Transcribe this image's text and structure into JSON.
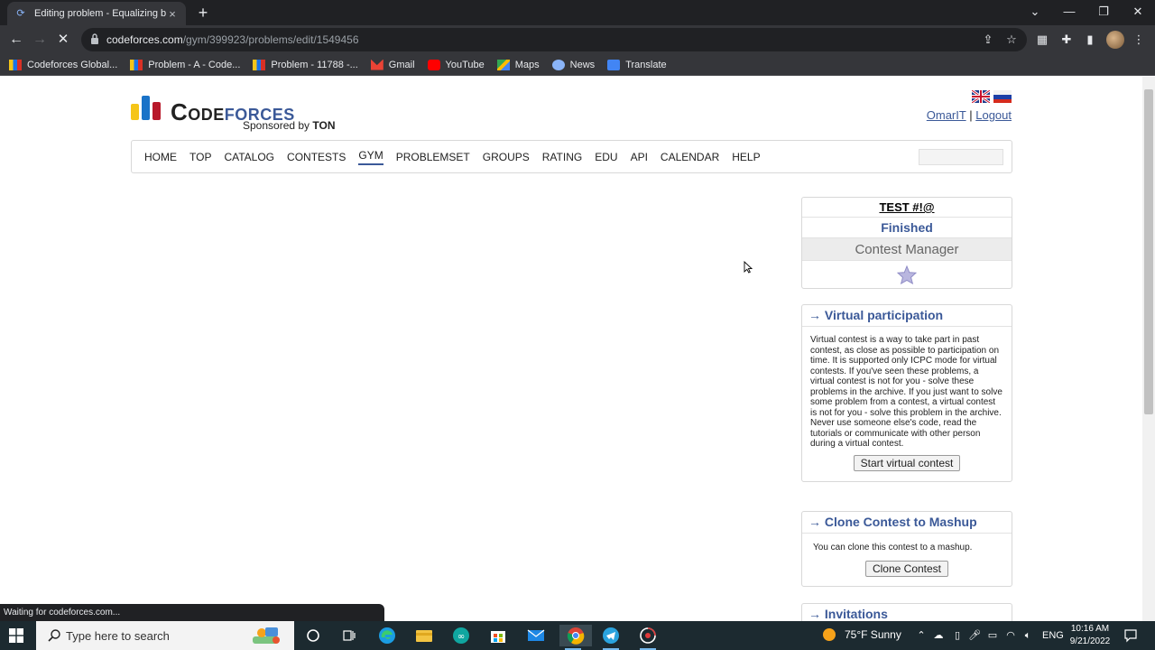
{
  "browser": {
    "tab_title": "Editing problem - Equalizing by ",
    "url_host": "codeforces.com",
    "url_path": "/gym/399923/problems/edit/1549456",
    "status_text": "Waiting for codeforces.com...",
    "bookmarks": [
      {
        "label": "Codeforces Global...",
        "icon": "codeforces-icon"
      },
      {
        "label": "Problem - A - Code...",
        "icon": "codeforces-icon"
      },
      {
        "label": "Problem - 11788 -...",
        "icon": "codeforces-icon"
      },
      {
        "label": "Gmail",
        "icon": "gmail-icon"
      },
      {
        "label": "YouTube",
        "icon": "youtube-icon"
      },
      {
        "label": "Maps",
        "icon": "maps-icon"
      },
      {
        "label": "News",
        "icon": "news-icon"
      },
      {
        "label": "Translate",
        "icon": "translate-icon"
      }
    ]
  },
  "site": {
    "logo_text_1": "Code",
    "logo_text_2": "forces",
    "sponsor_prefix": "Sponsored by",
    "sponsor_name": "TON",
    "user": "OmarIT",
    "separator": "|",
    "logout": "Logout",
    "menu": [
      "HOME",
      "TOP",
      "CATALOG",
      "CONTESTS",
      "GYM",
      "PROBLEMSET",
      "GROUPS",
      "RATING",
      "EDU",
      "API",
      "CALENDAR",
      "HELP"
    ],
    "active_menu": "GYM"
  },
  "sidebar": {
    "contest": {
      "name": "TEST #!@",
      "phase": "Finished",
      "manager": "Contest Manager"
    },
    "virtual": {
      "caption": "→ Virtual participation",
      "text": "Virtual contest is a way to take part in past contest, as close as possible to participation on time. It is supported only ICPC mode for virtual contests. If you've seen these problems, a virtual contest is not for you - solve these problems in the archive. If you just want to solve some problem from a contest, a virtual contest is not for you - solve this problem in the archive. Never use someone else's code, read the tutorials or communicate with other person during a virtual contest.",
      "button": "Start virtual contest"
    },
    "clone": {
      "caption": "→ Clone Contest to Mashup",
      "text": "You can clone this contest to a mashup.",
      "button": "Clone Contest"
    },
    "invitations": {
      "caption": "→ Invitations"
    }
  },
  "taskbar": {
    "search_placeholder": "Type here to search",
    "weather": "75°F  Sunny",
    "lang": "ENG",
    "time": "10:16 AM",
    "date": "9/21/2022"
  },
  "colors": {
    "cf_blue": "#3b5998",
    "chrome_dark": "#202124",
    "chrome_mid": "#35363a",
    "taskbar": "#1c2a30"
  }
}
